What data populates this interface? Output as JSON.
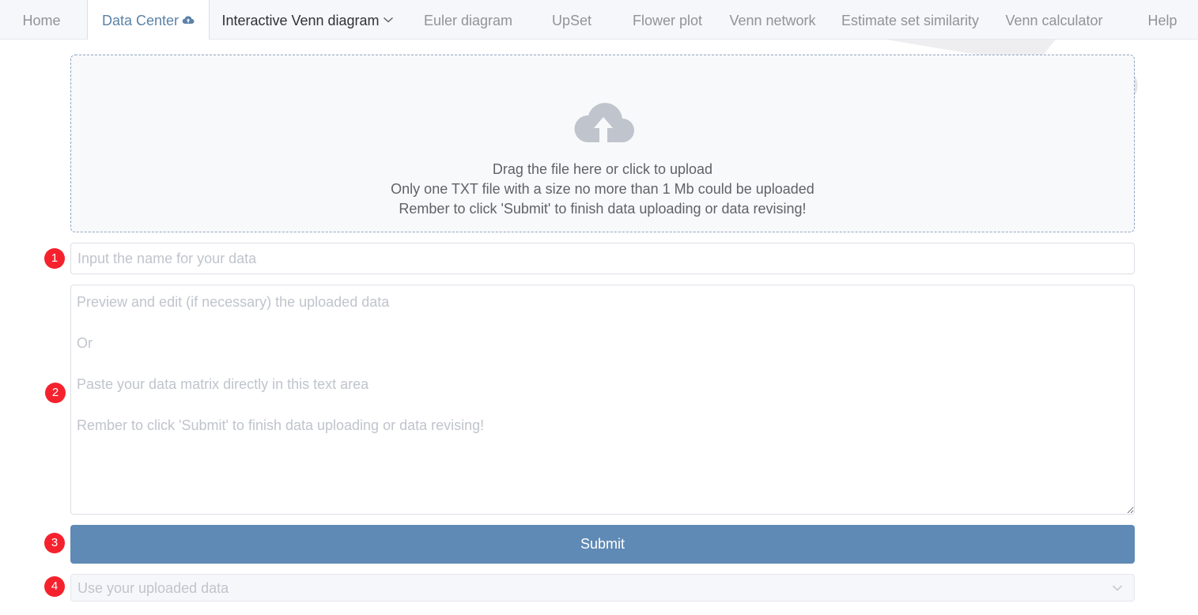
{
  "nav": {
    "items": [
      {
        "label": "Home"
      },
      {
        "label": "Data Center",
        "icon": "cloud-icon"
      },
      {
        "label": "Interactive Venn diagram",
        "icon": "chevron-down-icon"
      },
      {
        "label": "Euler diagram"
      },
      {
        "label": "UpSet"
      },
      {
        "label": "Flower plot"
      },
      {
        "label": "Venn network"
      },
      {
        "label": "Estimate set similarity"
      },
      {
        "label": "Venn calculator"
      },
      {
        "label": "Help"
      }
    ]
  },
  "upload": {
    "icon": "cloud-upload-icon",
    "line1": "Drag the file here or click to upload",
    "line2": "Only one TXT file with a size no more than 1 Mb could be uploaded",
    "line3": "Rember to click 'Submit' to finish data uploading or data revising!"
  },
  "steps": [
    "1",
    "2",
    "3",
    "4"
  ],
  "name_input": {
    "placeholder": "Input the name for your data",
    "value": ""
  },
  "data_area": {
    "placeholder": "Preview and edit (if necessary) the uploaded data\n\nOr\n\nPaste your data matrix directly in this text area\n\nRember to click 'Submit' to finish data uploading or data revising!"
  },
  "submit": {
    "label": "Submit"
  },
  "data_select": {
    "placeholder": "Use your uploaded data",
    "icon": "chevron-down-icon"
  },
  "colors": {
    "accent": "#5f8ab5",
    "active_tab": "#5b82a8",
    "badge": "#f5222d",
    "upload_border": "#8fa5bf"
  }
}
